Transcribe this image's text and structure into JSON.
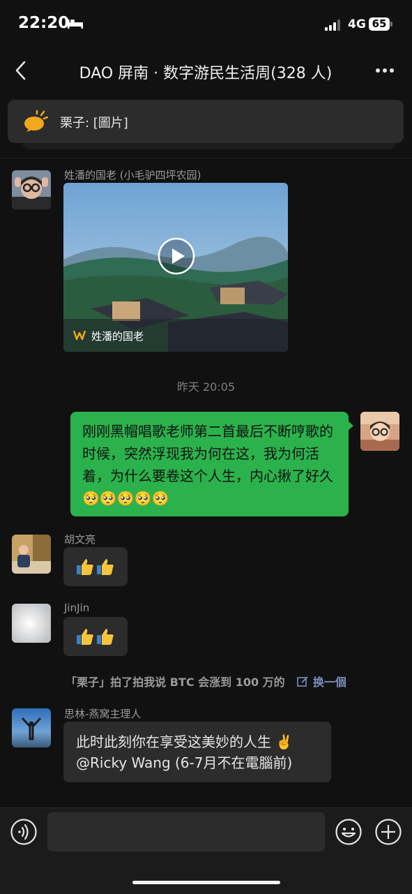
{
  "status": {
    "time": "22:20",
    "network": "4G",
    "battery": "65"
  },
  "header": {
    "title": "DAO 屏南 · 数字游民生活周(328 人)"
  },
  "pinned": {
    "text": "栗子: [圖片]"
  },
  "messages": {
    "video": {
      "sender": "姓潘的国老 (小毛驴四坪农园)",
      "caption": "姓潘的国老"
    },
    "timestamp": "昨天 20:05",
    "mine": {
      "text": "刚刚黑帽唱歌老师第二首最后不断哼歌的时候，突然浮现我为何在这，我为何活着，为什么要卷这个人生，内心揪了好久 🥺🥺🥺🥺🥺"
    },
    "hu": {
      "sender": "胡文亮"
    },
    "jinjin": {
      "sender": "JinJin"
    },
    "system": {
      "text": "「栗子」拍了拍我说 BTC 会涨到 100 万的",
      "link": "换一個"
    },
    "silin": {
      "sender": "思林-燕窝主理人",
      "line1": "此时此刻你在享受这美妙的人生 ✌️",
      "line2": "@Ricky Wang (6-7月不在電腦前)"
    }
  },
  "colors": {
    "accent": "#2bb24c",
    "background": "#111111",
    "bubble": "#2c2c2c"
  }
}
